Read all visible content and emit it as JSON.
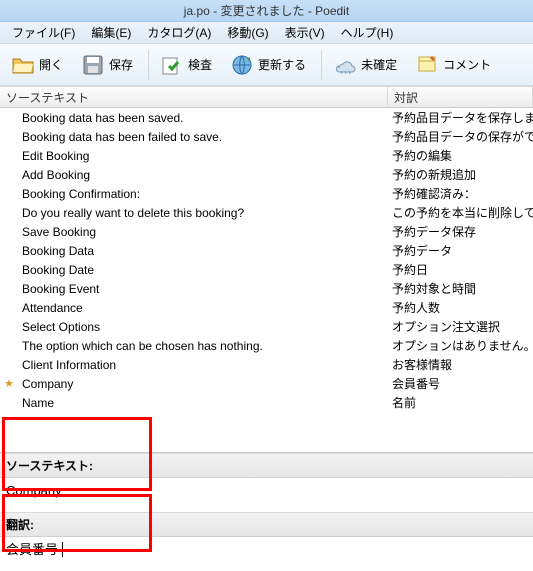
{
  "title": "ja.po - 変更されました - Poedit",
  "menu": {
    "file": "ファイル(F)",
    "edit": "編集(E)",
    "catalog": "カタログ(A)",
    "go": "移動(G)",
    "view": "表示(V)",
    "help": "ヘルプ(H)"
  },
  "toolbar": {
    "open": "開く",
    "save": "保存",
    "check": "検査",
    "update": "更新する",
    "untranslated": "未確定",
    "comment": "コメント"
  },
  "columns": {
    "source": "ソーステキスト",
    "target": "対訳"
  },
  "rows": [
    {
      "ind": "",
      "src": "Booking data has been saved.",
      "trg": "予約品目データを保存しました"
    },
    {
      "ind": "",
      "src": "Booking data has been failed to save.",
      "trg": "予約品目データの保存ができま"
    },
    {
      "ind": "",
      "src": "Edit Booking",
      "trg": "予約の編集"
    },
    {
      "ind": "",
      "src": "Add Booking",
      "trg": "予約の新規追加"
    },
    {
      "ind": "",
      "src": "Booking Confirmation:",
      "trg": "予約確認済み："
    },
    {
      "ind": "",
      "src": "Do you really want to delete this booking?",
      "trg": "この予約を本当に削除してもい"
    },
    {
      "ind": "",
      "src": "Save Booking",
      "trg": "予約データ保存"
    },
    {
      "ind": "",
      "src": "Booking Data",
      "trg": "予約データ"
    },
    {
      "ind": "",
      "src": "Booking Date",
      "trg": "予約日"
    },
    {
      "ind": "",
      "src": "Booking Event",
      "trg": "予約対象と時間"
    },
    {
      "ind": "",
      "src": "Attendance",
      "trg": "予約人数"
    },
    {
      "ind": "",
      "src": "Select Options",
      "trg": "オプション注文選択"
    },
    {
      "ind": "",
      "src": "The option which can be chosen has nothing.",
      "trg": "オプションはありません。"
    },
    {
      "ind": "",
      "src": "Client Information",
      "trg": "お客様情報"
    },
    {
      "ind": "★",
      "src": "Company",
      "trg": "会員番号"
    },
    {
      "ind": "",
      "src": "Name",
      "trg": "名前"
    }
  ],
  "pane": {
    "source_label": "ソーステキスト:",
    "source_value": "Company",
    "target_label": "翻訳:",
    "target_value": "会員番号"
  }
}
